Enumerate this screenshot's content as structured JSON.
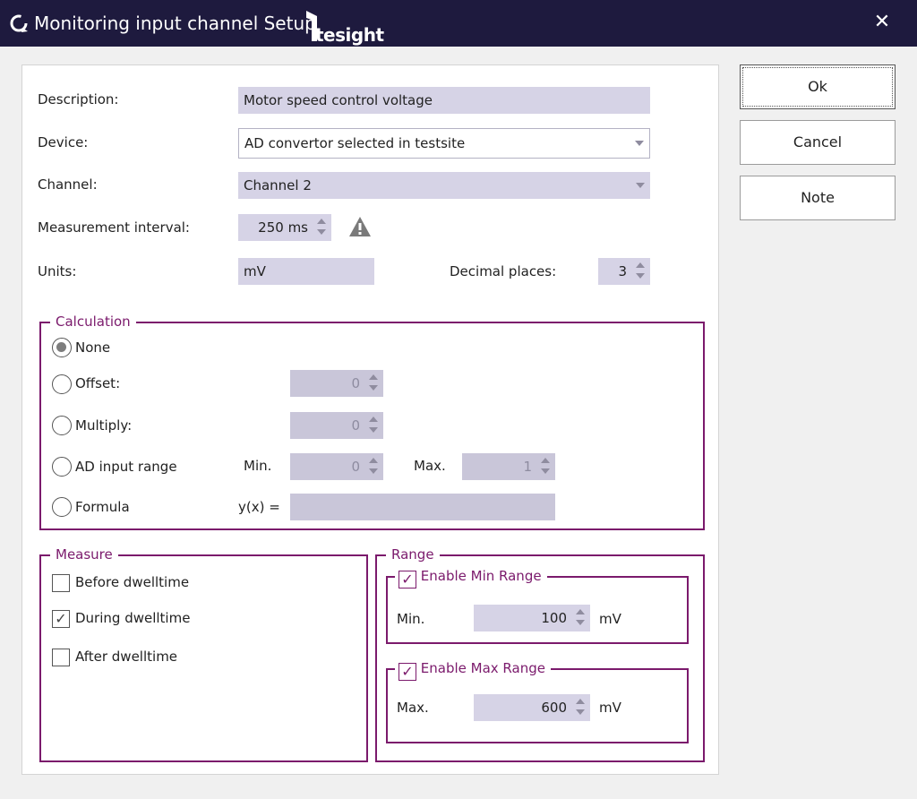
{
  "window": {
    "title": "Monitoring input channel Setup",
    "logo_text": "tesight",
    "close_glyph": "✕"
  },
  "form": {
    "description_label": "Description:",
    "description_value": "Motor speed control voltage",
    "device_label": "Device:",
    "device_value": "AD convertor selected in testsite",
    "channel_label": "Channel:",
    "channel_value": "Channel 2",
    "interval_label": "Measurement interval:",
    "interval_value": "250 ms",
    "units_label": "Units:",
    "units_value": "mV",
    "decimal_label": "Decimal places:",
    "decimal_value": "3"
  },
  "calculation": {
    "legend": "Calculation",
    "none_label": "None",
    "offset_label": "Offset:",
    "offset_value": "0",
    "multiply_label": "Multiply:",
    "multiply_value": "0",
    "ad_label": "AD input range",
    "ad_min_label": "Min.",
    "ad_min_value": "0",
    "ad_max_label": "Max.",
    "ad_max_value": "1",
    "formula_label": "Formula",
    "formula_prefix": "y(x) =",
    "formula_value": "",
    "selected": "none"
  },
  "measure": {
    "legend": "Measure",
    "before_label": "Before dwelltime",
    "before_checked": false,
    "during_label": "During dwelltime",
    "during_checked": true,
    "after_label": "After dwelltime",
    "after_checked": false
  },
  "range": {
    "legend": "Range",
    "enable_min_label": "Enable Min Range",
    "enable_min_checked": true,
    "min_label": "Min.",
    "min_value": "100",
    "min_unit": "mV",
    "enable_max_label": "Enable Max Range",
    "enable_max_checked": true,
    "max_label": "Max.",
    "max_value": "600",
    "max_unit": "mV"
  },
  "buttons": {
    "ok_label": "Ok",
    "cancel_label": "Cancel",
    "note_label": "Note"
  },
  "colors": {
    "titlebar": "#1e1a3e",
    "accent": "#7b1a6c",
    "field": "#d6d3e6"
  },
  "icons": {
    "app": "app-refresh-icon",
    "warning": "warning-triangle-icon",
    "close": "close-icon"
  }
}
